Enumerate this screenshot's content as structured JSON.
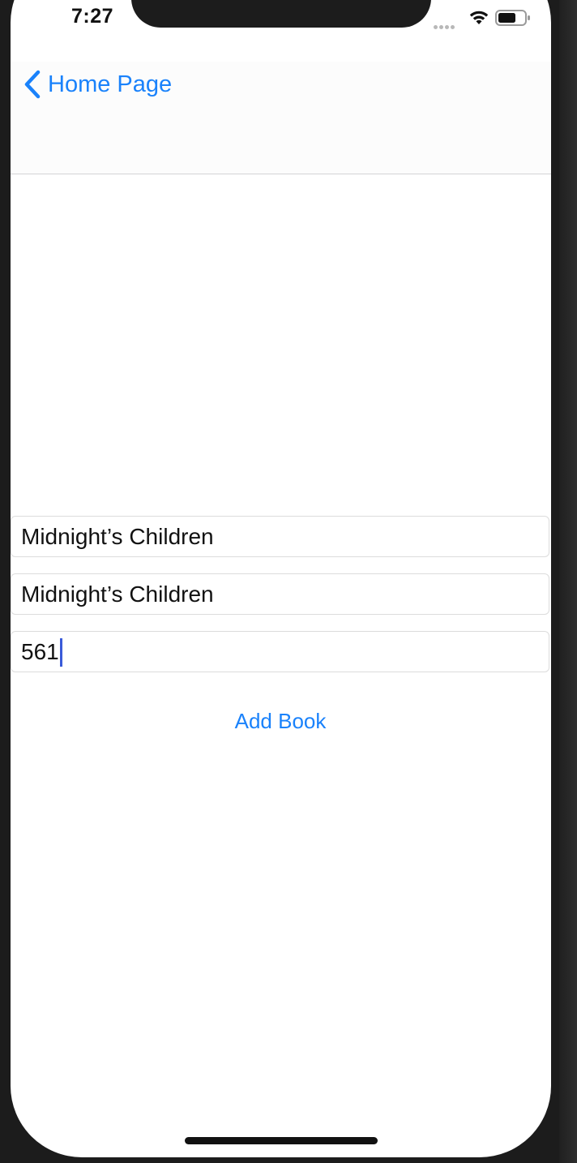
{
  "status_bar": {
    "time": "7:27",
    "wifi_icon": "wifi-icon",
    "battery_icon": "battery-icon"
  },
  "nav": {
    "back_icon": "chevron-left-icon",
    "back_label": "Home Page"
  },
  "form": {
    "fields": [
      {
        "value": "Midnight’s Children"
      },
      {
        "value": "Midnight’s Children"
      },
      {
        "value": "561"
      }
    ],
    "submit_label": "Add Book"
  },
  "colors": {
    "accent": "#1a82fb",
    "caret": "#3a5bd9",
    "bezel": "#1c1c1c"
  }
}
